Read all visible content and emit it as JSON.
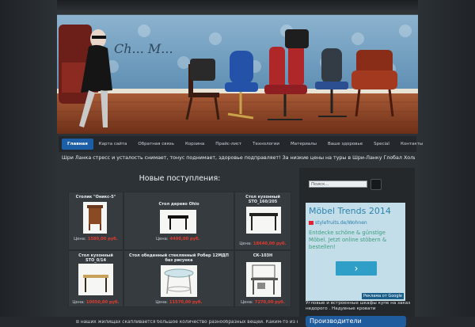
{
  "nav": {
    "items": [
      "Главная",
      "Карта сайта",
      "Обратная связь",
      "Корзина",
      "Прайс-лист",
      "Технологии",
      "Материалы",
      "Ваше здоровье",
      "Special",
      "Контакты"
    ]
  },
  "ticker": "Шри Ланка стресс и усталость снимает, тонус поднимает, здоровье подправляет! За низкие цены на туры в Шри-Ланку Глобал Холидей отвечает!",
  "section_title": "Новые поступления:",
  "products": [
    {
      "name": "Столик \"Оникс-5\"",
      "price_label": "Цена:",
      "price": "1580,00 руб."
    },
    {
      "name": "Стол дерево Ohio",
      "price_label": "Цена:",
      "price": "4490,00 руб."
    },
    {
      "name": "Стол кухонный STO_160/205",
      "price_label": "Цена:",
      "price": "18640,00 руб."
    },
    {
      "name": "Стол кухонный STO_0/14",
      "price_label": "Цена:",
      "price": "10050,00 руб."
    },
    {
      "name": "Стол обеденный стеклянный Робер 12МДП без рисунка",
      "price_label": "Цена:",
      "price": "11570,00 руб."
    },
    {
      "name": "СК-103Н",
      "price_label": "Цена:",
      "price": "7270,00 руб."
    }
  ],
  "body_text": "В наших жилищах скапливается большое количество разнообразных вещей. Каким-то из них",
  "sidebar": {
    "search_placeholder": "Поиск...",
    "ad": {
      "title": "Möbel Trends 2014",
      "source": "stylefruits.de/Wohnen",
      "text": "Entdecke schöne & günstige Möbel. Jetzt online stöbern & bestellen!",
      "button": "›",
      "footer": "Реклама от Google"
    },
    "note": "Угловые и встроенные шкафы купе на заказ недорого . Надувные кровати",
    "heading": "Производители"
  },
  "colors": {
    "accent": "#1d5fa6",
    "price": "#e23b2e",
    "background": "#262a2e"
  }
}
